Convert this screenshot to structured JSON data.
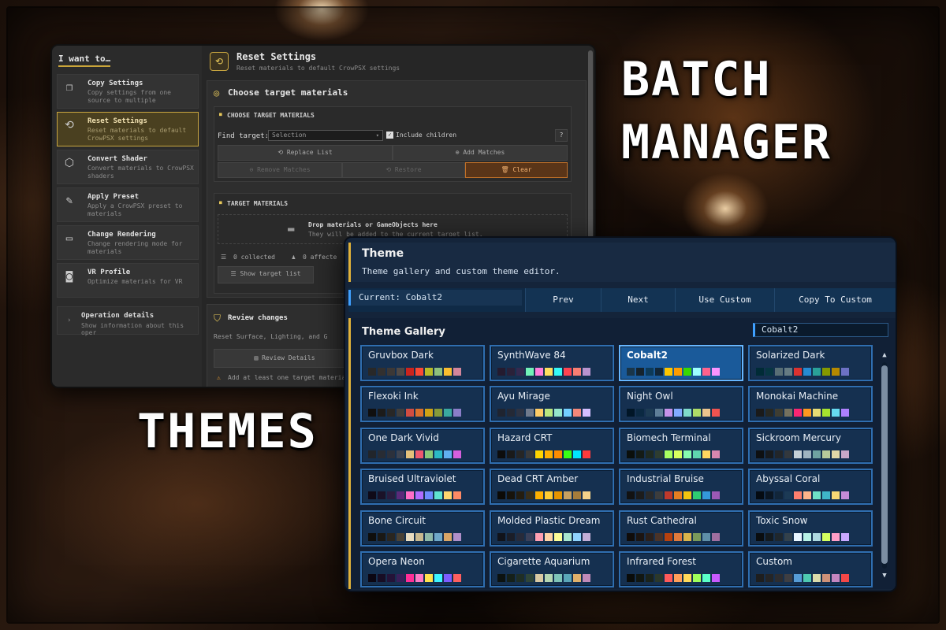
{
  "titles": {
    "batch": "BATCH",
    "manager": "MANAGER",
    "themes": "THEMES"
  },
  "batch_manager": {
    "sidebar_title": "I want to…",
    "items": [
      {
        "title": "Copy Settings",
        "desc": "Copy settings from one source to multiple",
        "icon": "copy-icon"
      },
      {
        "title": "Reset Settings",
        "desc": "Reset materials to default CrowPSX settings",
        "icon": "reset-icon",
        "active": true
      },
      {
        "title": "Convert Shader",
        "desc": "Convert materials to CrowPSX shaders",
        "icon": "cube-icon"
      },
      {
        "title": "Apply Preset",
        "desc": "Apply a CrowPSX preset to materials",
        "icon": "wand-icon"
      },
      {
        "title": "Change Rendering",
        "desc": "Change rendering mode for materials",
        "icon": "monitor-icon"
      },
      {
        "title": "VR Profile",
        "desc": "Optimize materials for VR",
        "icon": "vr-icon"
      }
    ],
    "operation_details": {
      "title": "Operation details",
      "desc": "Show information about this oper"
    },
    "header": {
      "title": "Reset Settings",
      "desc": "Reset materials to default CrowPSX settings"
    },
    "choose": {
      "title": "Choose target materials",
      "subtitle": "CHOOSE TARGET MATERIALS",
      "find_label": "Find target:",
      "find_value": "Selection",
      "include_children": "Include children",
      "help": "?",
      "replace_list": "Replace List",
      "add_matches": "Add Matches",
      "remove_matches": "Remove Matches",
      "restore": "Restore",
      "clear": "Clear"
    },
    "target": {
      "subtitle": "TARGET MATERIALS",
      "drop_title": "Drop materials or GameObjects here",
      "drop_desc": "They will be added to the current target list.",
      "collected": "0 collected",
      "affected": "0 affecte",
      "show_list": "Show target list"
    },
    "review": {
      "title": "Review changes",
      "desc": "Reset Surface, Lighting, and G",
      "details_btn": "Review Details",
      "warning": "Add at least one target materia"
    }
  },
  "theme_window": {
    "title": "Theme",
    "subtitle": "Theme gallery and custom theme editor.",
    "current": "Current: Cobalt2",
    "buttons": {
      "prev": "Prev",
      "next": "Next",
      "use_custom": "Use Custom",
      "copy_to_custom": "Copy To Custom"
    },
    "gallery_title": "Theme Gallery",
    "search_value": "Cobalt2",
    "themes": [
      {
        "name": "Gruvbox Dark",
        "colors": [
          "#282828",
          "#32302f",
          "#3c3836",
          "#504945",
          "#cc241d",
          "#fb4934",
          "#b8bb26",
          "#8ec07c",
          "#fabd2f",
          "#d3869b"
        ]
      },
      {
        "name": "SynthWave 84",
        "colors": [
          "#241b2f",
          "#2a2139",
          "#34294f",
          "#72f1b8",
          "#ff7edb",
          "#fede5d",
          "#36f9f6",
          "#fe4450",
          "#f97e72",
          "#b893ce"
        ]
      },
      {
        "name": "Cobalt2",
        "colors": [
          "#193549",
          "#15232d",
          "#0d3a58",
          "#122738",
          "#ffc600",
          "#ff9d00",
          "#3ad900",
          "#9effff",
          "#ff628c",
          "#fb94ff"
        ],
        "selected": true
      },
      {
        "name": "Solarized Dark",
        "colors": [
          "#002b36",
          "#073642",
          "#586e75",
          "#657b83",
          "#dc322f",
          "#268bd2",
          "#2aa198",
          "#859900",
          "#b58900",
          "#6c71c4"
        ]
      },
      {
        "name": "Flexoki Ink",
        "colors": [
          "#100f0f",
          "#1c1b1a",
          "#282726",
          "#403e3c",
          "#d14d41",
          "#da702c",
          "#d0a215",
          "#879a39",
          "#3aa99f",
          "#8b7ec8"
        ]
      },
      {
        "name": "Ayu Mirage",
        "colors": [
          "#1f2430",
          "#242936",
          "#2d3343",
          "#707a8c",
          "#ffcc66",
          "#bae67e",
          "#95e6cb",
          "#73d0ff",
          "#f28779",
          "#d4bfff"
        ]
      },
      {
        "name": "Night Owl",
        "colors": [
          "#011627",
          "#0b2942",
          "#1d3b53",
          "#5f7e97",
          "#c792ea",
          "#82aaff",
          "#7fdbca",
          "#addb67",
          "#ecc48d",
          "#ef5350"
        ]
      },
      {
        "name": "Monokai Machine",
        "colors": [
          "#1a1a1a",
          "#272822",
          "#3e3d32",
          "#75715e",
          "#f92672",
          "#fd971f",
          "#e6db74",
          "#a6e22e",
          "#66d9ef",
          "#ae81ff"
        ]
      },
      {
        "name": "One Dark Vivid",
        "colors": [
          "#21252b",
          "#282c34",
          "#2c313c",
          "#3e4451",
          "#e5c07b",
          "#ef596f",
          "#89ca78",
          "#2bbac5",
          "#61afef",
          "#d55fde"
        ]
      },
      {
        "name": "Hazard CRT",
        "colors": [
          "#0d0d0d",
          "#1a1a1a",
          "#262626",
          "#3a3a3a",
          "#ffd400",
          "#ffb000",
          "#ff8c00",
          "#39ff14",
          "#00e5ff",
          "#ff3b3b"
        ]
      },
      {
        "name": "Biomech Terminal",
        "colors": [
          "#0b0f0c",
          "#141b16",
          "#1f2a21",
          "#2e3d30",
          "#a8ff60",
          "#d7ff5f",
          "#87ffaf",
          "#5fd7af",
          "#ffd75f",
          "#d787af"
        ]
      },
      {
        "name": "Sickroom Mercury",
        "colors": [
          "#0e1012",
          "#181b1e",
          "#22262a",
          "#33383d",
          "#c6d0d6",
          "#9fb4c0",
          "#6fa3a1",
          "#b7c99a",
          "#e0d7a8",
          "#c7a8c9"
        ]
      },
      {
        "name": "Bruised Ultraviolet",
        "colors": [
          "#0f0a18",
          "#1a1228",
          "#2a1d40",
          "#5a2a7a",
          "#ff6ec7",
          "#b06cff",
          "#6c8cff",
          "#5fe3d0",
          "#ffd66e",
          "#ff8a65"
        ]
      },
      {
        "name": "Dead CRT Amber",
        "colors": [
          "#0c0a06",
          "#17130b",
          "#241d10",
          "#3a2f19",
          "#ffb000",
          "#ffcc33",
          "#e69500",
          "#c8a060",
          "#a67c3a",
          "#f5d38a"
        ]
      },
      {
        "name": "Industrial Bruise",
        "colors": [
          "#121212",
          "#1c1c1c",
          "#2a2a2a",
          "#3d3d3d",
          "#c0392b",
          "#e67e22",
          "#f1c40f",
          "#2ecc71",
          "#3498db",
          "#9b59b6"
        ]
      },
      {
        "name": "Abyssal Coral",
        "colors": [
          "#050b12",
          "#0b1622",
          "#12263a",
          "#1c3a55",
          "#ff7f6e",
          "#ffb38a",
          "#6fe3c6",
          "#3fb6c8",
          "#f7d774",
          "#c48bd8"
        ]
      },
      {
        "name": "Bone Circuit",
        "colors": [
          "#0f0e0c",
          "#1a1814",
          "#2a2620",
          "#4a4236",
          "#e8dcc0",
          "#c9b98f",
          "#8fb9a8",
          "#6fa8c9",
          "#d9a566",
          "#b08fc9"
        ]
      },
      {
        "name": "Molded Plastic Dream",
        "colors": [
          "#11131a",
          "#1b1e28",
          "#272b3a",
          "#3a4058",
          "#ff9fb2",
          "#ffd3a5",
          "#fdfd96",
          "#a8e6cf",
          "#8fd3fe",
          "#c3aed6"
        ]
      },
      {
        "name": "Rust Cathedral",
        "colors": [
          "#100c0a",
          "#1c1512",
          "#2b201b",
          "#4a3328",
          "#b7410e",
          "#e07a3c",
          "#d9b44a",
          "#7a9a5a",
          "#5f8fa8",
          "#a06fa0"
        ]
      },
      {
        "name": "Toxic Snow",
        "colors": [
          "#0a0d0f",
          "#141a1e",
          "#1f272d",
          "#33414b",
          "#eaf6ff",
          "#b8f2e6",
          "#aed9e0",
          "#d4ff5f",
          "#ff9ec7",
          "#c9a8ff"
        ]
      },
      {
        "name": "Opera Neon",
        "colors": [
          "#0b0612",
          "#170d24",
          "#241338",
          "#3a1f5a",
          "#ff2e97",
          "#ff7ac6",
          "#ffe14d",
          "#3df5ff",
          "#7d5cff",
          "#ff5f5f"
        ]
      },
      {
        "name": "Cigarette Aquarium",
        "colors": [
          "#0c1210",
          "#152019",
          "#1f2e25",
          "#2f4538",
          "#d9c9a3",
          "#b5d6b2",
          "#7ec4b8",
          "#5aa6b8",
          "#e0b06a",
          "#c08ab8"
        ]
      },
      {
        "name": "Infrared Forest",
        "colors": [
          "#0a0c0a",
          "#121712",
          "#1b231b",
          "#2b382b",
          "#ff5a5a",
          "#ff9f5a",
          "#ffd95a",
          "#9fff5a",
          "#5affc8",
          "#c85aff"
        ]
      },
      {
        "name": "Custom",
        "colors": [
          "#1e1e1e",
          "#252526",
          "#2d2d30",
          "#3e3e42",
          "#569cd6",
          "#4ec9b0",
          "#dcdcaa",
          "#ce9178",
          "#c586c0",
          "#f44747"
        ]
      }
    ]
  }
}
